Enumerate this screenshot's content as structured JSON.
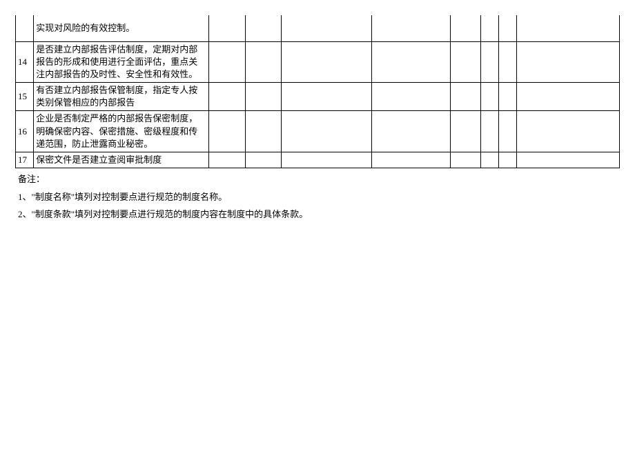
{
  "table": {
    "rows": [
      {
        "num": "",
        "desc": "实现对风险的有效控制。",
        "partial": true
      },
      {
        "num": "14",
        "desc": "是否建立内部报告评估制度，定期对内部报告的形成和使用进行全面评估，重点关注内部报告的及时性、安全性和有效性。"
      },
      {
        "num": "15",
        "desc": "有否建立内部报告保管制度，指定专人按类别保管相应的内部报告"
      },
      {
        "num": "16",
        "desc": "企业是否制定严格的内部报告保密制度，明确保密内容、保密措施、密级程度和传递范围，防止泄露商业秘密。"
      },
      {
        "num": "17",
        "desc": "保密文件是否建立查阅审批制度"
      }
    ]
  },
  "notes": {
    "label": "备注：",
    "items": [
      "1、\"制度名称\"填列对控制要点进行规范的制度名称。",
      "2、\"制度条款\"填列对控制要点进行规范的制度内容在制度中的具体条款。"
    ]
  }
}
